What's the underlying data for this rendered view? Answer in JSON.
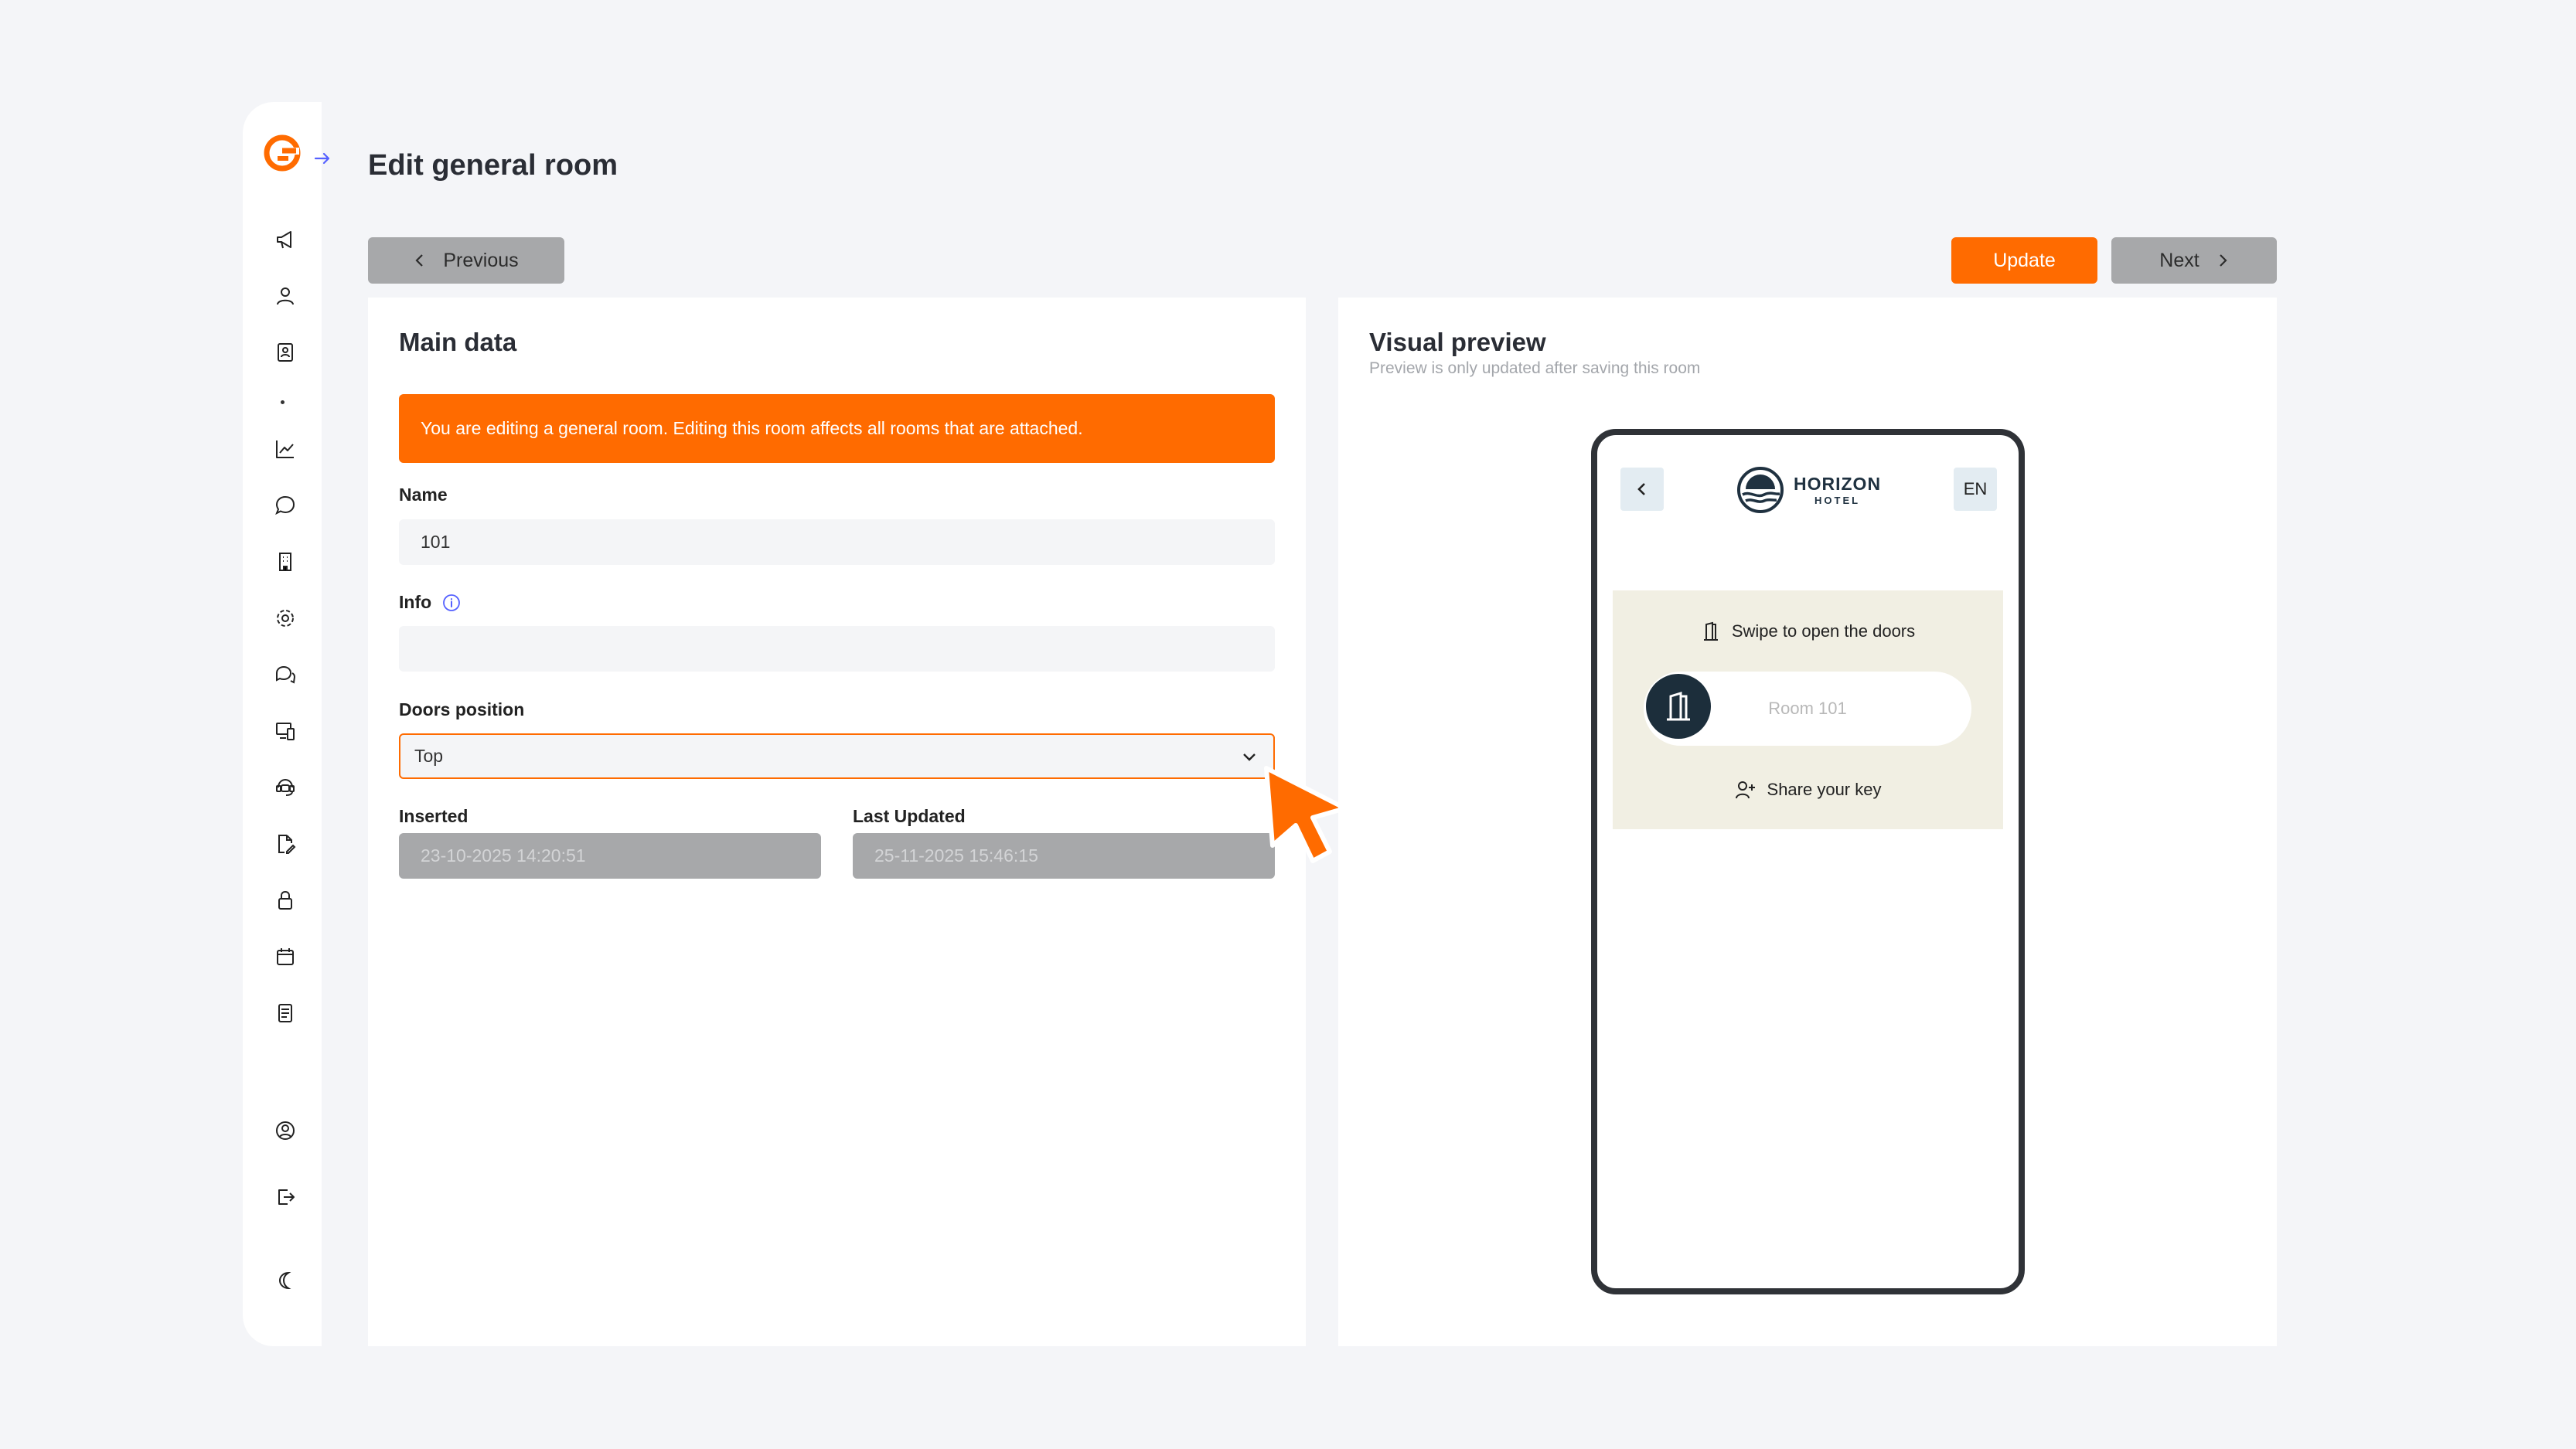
{
  "page": {
    "title": "Edit general room"
  },
  "toolbar": {
    "previous_label": "Previous",
    "update_label": "Update",
    "next_label": "Next"
  },
  "sidebar": {
    "items": [
      {
        "icon": "megaphone-icon"
      },
      {
        "icon": "users-icon"
      },
      {
        "icon": "contact-book-icon"
      },
      {
        "icon": "chart-line-icon"
      },
      {
        "icon": "chat-bubble-icon"
      },
      {
        "icon": "building-icon"
      },
      {
        "icon": "settings-gear-icon"
      },
      {
        "icon": "messages-icon"
      },
      {
        "icon": "devices-icon"
      },
      {
        "icon": "support-agent-icon"
      },
      {
        "icon": "document-edit-icon"
      },
      {
        "icon": "lock-icon"
      },
      {
        "icon": "calendar-icon"
      },
      {
        "icon": "notes-icon"
      },
      {
        "icon": "account-circle-icon"
      },
      {
        "icon": "logout-icon"
      },
      {
        "icon": "dark-mode-moon-icon"
      }
    ]
  },
  "main_data": {
    "title": "Main data",
    "alert": "You are editing a general room. Editing this room affects all rooms that are attached.",
    "name_label": "Name",
    "name_value": "101",
    "info_label": "Info",
    "info_value": "",
    "doors_position_label": "Doors position",
    "doors_position_value": "Top",
    "inserted_label": "Inserted",
    "inserted_value": "23-10-2025 14:20:51",
    "last_updated_label": "Last Updated",
    "last_updated_value": "25-11-2025 15:46:15"
  },
  "visual_preview": {
    "title": "Visual preview",
    "subtitle": "Preview is only updated after saving this room",
    "phone": {
      "brand_name": "HORIZON",
      "brand_sub": "HOTEL",
      "language": "EN",
      "swipe_text": "Swipe to open the doors",
      "room_label": "Room 101",
      "share_key_label": "Share your key"
    }
  },
  "colors": {
    "accent": "#ff6b00",
    "button_grey": "#a7a8aa",
    "page_bg": "#f4f5f8",
    "preview_card": "#f1efe3",
    "knob": "#1c2e3b"
  }
}
